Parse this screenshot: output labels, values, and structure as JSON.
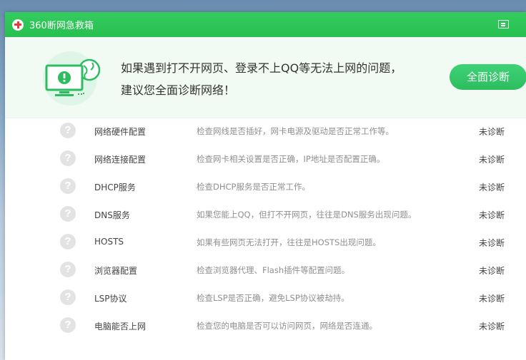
{
  "window": {
    "title": "360断网急救箱"
  },
  "banner": {
    "line1": "如果遇到打不开网页、登录不上QQ等无法上网的问题，",
    "line2": "建议您全面诊断网络！",
    "button_label": "全面诊断"
  },
  "colors": {
    "titlebar": "#2fc759",
    "accent": "#34c76a",
    "banner_bg": "#f1fbf4"
  },
  "items": [
    {
      "name": "网络硬件配置",
      "desc": "检查网线是否插好，网卡电源及驱动是否正常工作等。",
      "status": "未诊断"
    },
    {
      "name": "网络连接配置",
      "desc": "检查网卡相关设置是否正确，IP地址是否配置正确。",
      "status": "未诊断"
    },
    {
      "name": "DHCP服务",
      "desc": "检查DHCP服务是否正常工作。",
      "status": "未诊断"
    },
    {
      "name": "DNS服务",
      "desc": "如果您能上QQ，但打不开网页，往往是DNS服务出现问题。",
      "status": "未诊断"
    },
    {
      "name": "HOSTS",
      "desc": "如果有些网页无法打开，往往是HOSTS出现问题。",
      "status": "未诊断"
    },
    {
      "name": "浏览器配置",
      "desc": "检查浏览器代理、Flash插件等配置问题。",
      "status": "未诊断"
    },
    {
      "name": "LSP协议",
      "desc": "检查LSP是否正确，避免LSP协议被劫持。",
      "status": "未诊断"
    },
    {
      "name": "电脑能否上网",
      "desc": "检查您的电脑是否可以访问网页，网络是否连通。",
      "status": "未诊断"
    }
  ]
}
